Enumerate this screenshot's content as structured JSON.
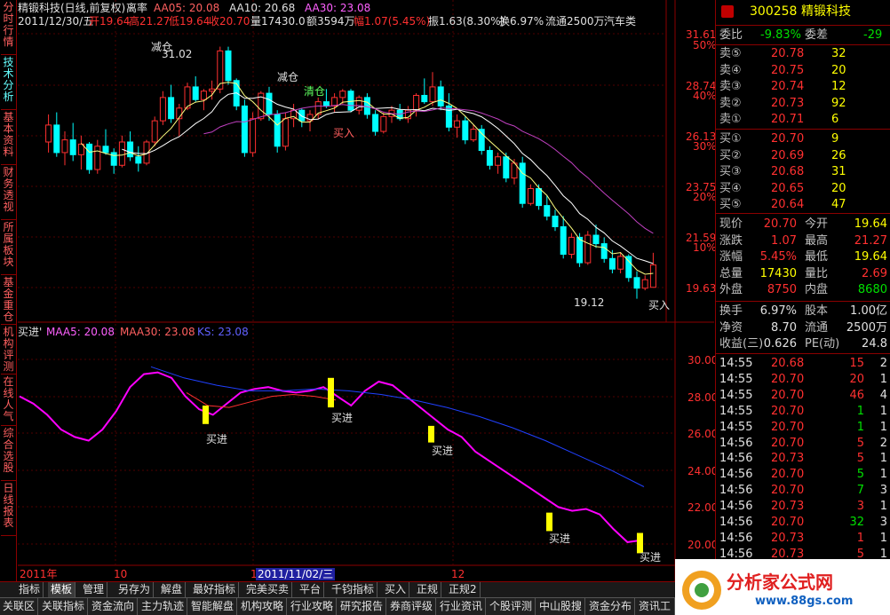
{
  "left_tabs": [
    "分时行情",
    "技术分析",
    "基本资料",
    "财务透视",
    "所属板块",
    "基金重仓",
    "机构评测",
    "在线人气",
    "综合选股",
    "日线报表"
  ],
  "header": {
    "stock_name": "精锻科技(日线,前复权)",
    "mode": "离率",
    "ma5_label": "AA05: 20.08",
    "ma10_label": "AA10: 20.68",
    "ma30_label": "AA30: 23.08",
    "date": "2011/12/30/五",
    "open": "开19.64",
    "high": "高21.27",
    "low": "低19.64",
    "close": "收20.70",
    "volume": "量17430.0",
    "amount": "额3594万",
    "change_pct": "幅1.07(5.45%)",
    "amplitude": "振1.63(8.30%)",
    "turnover": "换6.97%",
    "float": "流通2500万",
    "industry": "汽车类"
  },
  "price_axis": [
    "31.61",
    "28.74",
    "26.13",
    "23.75",
    "21.59",
    "19.63"
  ],
  "pct_axis": [
    "50%",
    "40%",
    "30%",
    "20%",
    "10%"
  ],
  "annotations": {
    "reduce1": "减仓",
    "high_price": "31.02",
    "reduce2": "减仓",
    "clear": "清仓",
    "buy1": "买入",
    "low_price": "19.12",
    "buy2": "买入"
  },
  "sub_header": {
    "name": "买进'",
    "maa5": "MAA5: 20.08",
    "maa30": "MAA30: 23.08",
    "ks": "KS: 23.08"
  },
  "sub_axis": [
    "30.00",
    "28.00",
    "26.00",
    "24.00",
    "22.00",
    "20.00"
  ],
  "sub_buy_label": "买进",
  "time_axis": {
    "t1": "2011年",
    "t2": "10",
    "t3": "1",
    "t4": "2011/11/02/三",
    "t5": "12",
    "period": "日线"
  },
  "bottom_tabs": [
    "指标",
    "模板",
    "管理",
    "另存为",
    "解盘",
    "最好指标",
    "完美买卖",
    "平台",
    "千钧指标",
    "买入",
    "正规",
    "正规2"
  ],
  "menu_tabs": [
    "关联区",
    "关联指标",
    "资金流向",
    "主力轨迹",
    "智能解盘",
    "机构攻略",
    "行业攻略",
    "研究报告",
    "券商评级",
    "行业资讯",
    "个股评测",
    "中山股搜",
    "资金分布",
    "资讯工场"
  ],
  "quote": {
    "code": "300258",
    "name": "精锻科技",
    "weibi_label": "委比",
    "weibi": "-9.83%",
    "weicha_label": "委差",
    "weicha": "-29",
    "sells": [
      {
        "label": "卖⑤",
        "price": "20.78",
        "vol": "32"
      },
      {
        "label": "卖④",
        "price": "20.75",
        "vol": "20"
      },
      {
        "label": "卖③",
        "price": "20.74",
        "vol": "12"
      },
      {
        "label": "卖②",
        "price": "20.73",
        "vol": "92"
      },
      {
        "label": "卖①",
        "price": "20.71",
        "vol": "6"
      }
    ],
    "buys": [
      {
        "label": "买①",
        "price": "20.70",
        "vol": "9"
      },
      {
        "label": "买②",
        "price": "20.69",
        "vol": "26"
      },
      {
        "label": "买③",
        "price": "20.68",
        "vol": "31"
      },
      {
        "label": "买④",
        "price": "20.65",
        "vol": "20"
      },
      {
        "label": "买⑤",
        "price": "20.64",
        "vol": "47"
      }
    ],
    "stats": [
      {
        "l1": "现价",
        "v1": "20.70",
        "c1": "red",
        "l2": "今开",
        "v2": "19.64",
        "c2": "yel"
      },
      {
        "l1": "涨跌",
        "v1": "1.07",
        "c1": "red",
        "l2": "最高",
        "v2": "21.27",
        "c2": "red"
      },
      {
        "l1": "涨幅",
        "v1": "5.45%",
        "c1": "red",
        "l2": "最低",
        "v2": "19.64",
        "c2": "yel"
      },
      {
        "l1": "总量",
        "v1": "17430",
        "c1": "yel",
        "l2": "量比",
        "v2": "2.69",
        "c2": "red"
      },
      {
        "l1": "外盘",
        "v1": "8750",
        "c1": "red",
        "l2": "内盘",
        "v2": "8680",
        "c2": "grn"
      }
    ],
    "stats2": [
      {
        "l1": "换手",
        "v1": "6.97%",
        "l2": "股本",
        "v2": "1.00亿"
      },
      {
        "l1": "净资",
        "v1": "8.70",
        "l2": "流通",
        "v2": "2500万"
      },
      {
        "l1": "收益(三)",
        "v1": "0.626",
        "l2": "PE(动)",
        "v2": "24.8"
      }
    ],
    "ticks": [
      {
        "t": "14:55",
        "p": "20.68",
        "v": "15",
        "n": "2",
        "pc": "red",
        "vc": "red"
      },
      {
        "t": "14:55",
        "p": "20.70",
        "v": "20",
        "n": "1",
        "pc": "red",
        "vc": "red"
      },
      {
        "t": "14:55",
        "p": "20.70",
        "v": "46",
        "n": "4",
        "pc": "red",
        "vc": "red"
      },
      {
        "t": "14:55",
        "p": "20.70",
        "v": "1",
        "n": "1",
        "pc": "red",
        "vc": "grn"
      },
      {
        "t": "14:55",
        "p": "20.70",
        "v": "1",
        "n": "1",
        "pc": "red",
        "vc": "grn"
      },
      {
        "t": "14:56",
        "p": "20.70",
        "v": "5",
        "n": "2",
        "pc": "red",
        "vc": "red"
      },
      {
        "t": "14:56",
        "p": "20.73",
        "v": "5",
        "n": "1",
        "pc": "red",
        "vc": "red"
      },
      {
        "t": "14:56",
        "p": "20.70",
        "v": "5",
        "n": "1",
        "pc": "red",
        "vc": "grn"
      },
      {
        "t": "14:56",
        "p": "20.70",
        "v": "7",
        "n": "3",
        "pc": "red",
        "vc": "grn"
      },
      {
        "t": "14:56",
        "p": "20.73",
        "v": "3",
        "n": "1",
        "pc": "red",
        "vc": "red"
      },
      {
        "t": "14:56",
        "p": "20.70",
        "v": "32",
        "n": "3",
        "pc": "red",
        "vc": "grn"
      },
      {
        "t": "14:56",
        "p": "20.73",
        "v": "1",
        "n": "1",
        "pc": "red",
        "vc": "red"
      },
      {
        "t": "14:56",
        "p": "20.73",
        "v": "5",
        "n": "1",
        "pc": "red",
        "vc": "red"
      }
    ]
  },
  "logo_text": "分析家公式网",
  "logo_url": "www.88gs.com",
  "colors": {
    "up": "#ff3030",
    "down": "#00ffff",
    "ma5": "#ffff80",
    "ma30": "#c040c0",
    "magenta": "#ff00ff",
    "blue": "#2040ff",
    "grid": "#8b0000"
  }
}
